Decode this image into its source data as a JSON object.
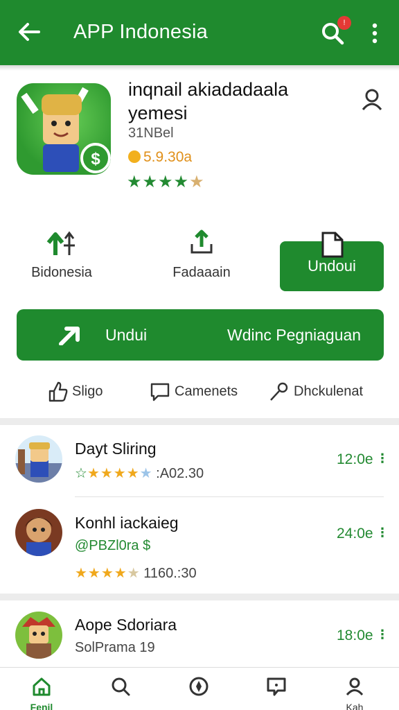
{
  "header": {
    "title": "APP Indonesia",
    "notification_count": "!",
    "accent": "#1f8a2e"
  },
  "app": {
    "name": "inqnail akiadadaala yemesi",
    "developer": "31NBel",
    "price": "5.9.30a",
    "rating_stars": "★★★★",
    "rating_half": "★"
  },
  "actions": {
    "left_label": "Bidonesia",
    "middle_label": "Fadaaain",
    "install_label": "Undoui"
  },
  "big_button": {
    "left_label": "Undui",
    "right_label": "Wdinc Pegniaguan"
  },
  "social": {
    "like_label": "Sligo",
    "comment_label": "Camenets",
    "share_label": "Dhckulenat"
  },
  "rows": [
    {
      "title": "Dayt Sliring",
      "stars": "★★★★",
      "half_star": "★",
      "meta": ":A02.30",
      "time": "12:0e",
      "more": "⋮"
    },
    {
      "title": "Konhl iackaieg",
      "price_line": "@PBZl0ra $",
      "stars": "★★★★",
      "half_star": "★",
      "meta": "1160.:30",
      "time": "24:0e",
      "more": "⋮"
    },
    {
      "title": "Aope Sdoriara",
      "meta": "SolPrama 19",
      "time": "18:0e",
      "more": "⋮"
    }
  ],
  "bottom_nav": {
    "home_label": "Fenil",
    "profile_label": "Kah"
  }
}
